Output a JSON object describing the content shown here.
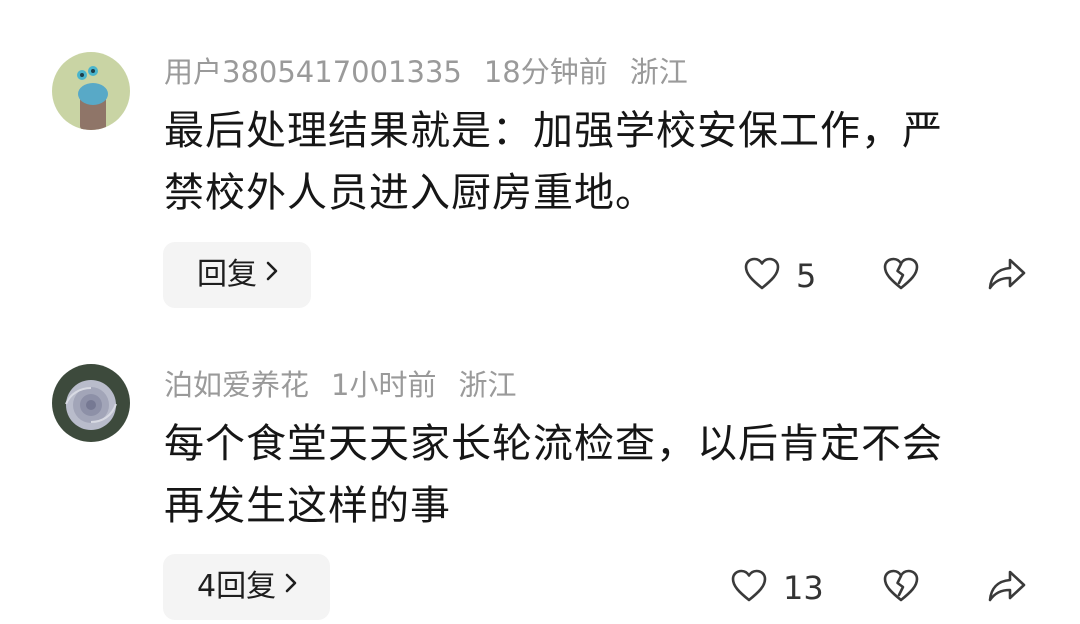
{
  "comments": [
    {
      "username": "用户3805417001335",
      "time": "18分钟前",
      "location": "浙江",
      "lines": [
        "最后处理结果就是：加强学校安保工作，严",
        "禁校外人员进入厨房重地。"
      ],
      "reply_label": "回复",
      "like_count": "5",
      "avatar": "cartoon-avatar"
    },
    {
      "username": "泊如爱养花",
      "time": "1小时前",
      "location": "浙江",
      "lines": [
        "每个食堂天天家长轮流检查，以后肯定不会",
        "再发生这样的事"
      ],
      "reply_label": "4回复",
      "like_count": "13",
      "avatar": "flower-avatar"
    }
  ],
  "icons": {
    "like": "heart-outline-icon",
    "dislike": "broken-heart-icon",
    "share": "share-arrow-icon",
    "chevron": "chevron-right-icon"
  }
}
